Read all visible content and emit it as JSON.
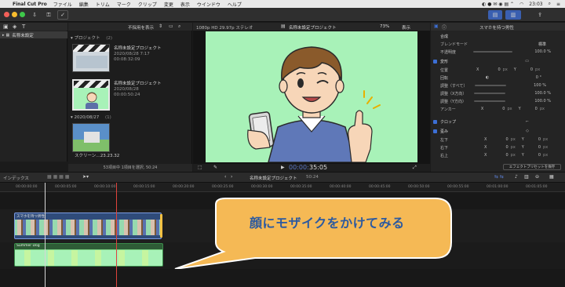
{
  "menubar": {
    "app_name": "Final Cut Pro",
    "items": [
      "ファイル",
      "編集",
      "トリム",
      "マーク",
      "クリップ",
      "変更",
      "表示",
      "ウインドウ",
      "ヘルプ"
    ],
    "clock": "23:03"
  },
  "toolbar": {
    "filter_label": "不採用を表示"
  },
  "library": {
    "name": "名称未設定"
  },
  "browser": {
    "section_projects": "プロジェクト",
    "section_projects_count": "(2)",
    "clips": [
      {
        "title": "名称未設定プロジェクト",
        "date": "2020/08/28 7:17",
        "duration": "00:08:32:09"
      },
      {
        "title": "名称未設定プロジェクト",
        "date": "2020/08/28",
        "duration": "00:00:50:24"
      }
    ],
    "section_date": "2020/08/27",
    "section_date_count": "(1)",
    "media_label": "スクリーン…23.23.32",
    "status": "53項目中 1項目を選択, 50:24"
  },
  "viewer": {
    "format": "1080p HD 29.97p ステレオ",
    "project_name": "名称未設定プロジェクト",
    "zoom": "73%",
    "view_label": "表示",
    "timecode": "35:05"
  },
  "inspector": {
    "clip_name": "スマホを持つ男性",
    "section_composite": "合成",
    "blend_mode_label": "ブレンドモード",
    "blend_mode_value": "標準",
    "opacity_label": "不透明度",
    "opacity_value": "100.0 %",
    "transform_label": "変形",
    "position_label": "位置",
    "pos_x": "0",
    "pos_y": "0",
    "unit_px": "px",
    "rotation_label": "回転",
    "rotation_value": "0 °",
    "scale_all_label": "調整（すべて）",
    "scale_all_value": "100 %",
    "scale_x_label": "調整（X方向）",
    "scale_x_value": "100.0 %",
    "scale_y_label": "調整（Y方向）",
    "scale_y_value": "100.0 %",
    "anchor_label": "アンカー",
    "anchor_x": "0",
    "anchor_y": "0",
    "crop_label": "クロップ",
    "distort_label": "歪み",
    "bl_label": "左下",
    "br_label": "右下",
    "tr_label": "右上",
    "save_preset": "エフェクトプリセットを保存"
  },
  "timeline": {
    "index_label": "インデックス",
    "project_name": "名称未設定プロジェクト",
    "duration": "50:24",
    "ruler_ticks": [
      "00:00:00:00",
      "00:00:05:00",
      "00:00:10:00",
      "00:00:15:00",
      "00:00:20:00",
      "00:00:25:00",
      "00:00:30:00",
      "00:00:35:00",
      "00:00:40:00",
      "00:00:45:00",
      "00:00:50:00",
      "00:00:55:00",
      "00:01:00:00",
      "00:01:05:00"
    ],
    "clip_video_label": "スマホを持つ男性",
    "clip_audio_label": "Summer Dog"
  },
  "callout": {
    "text": "顔にモザイクをかけてみる",
    "fill": "#f5b955",
    "text_color": "#2c5aa0"
  },
  "colors": {
    "accent_blue": "#3c6fd6",
    "video_bg_green": "#a8f2b8",
    "playhead_red": "#e0433c"
  }
}
